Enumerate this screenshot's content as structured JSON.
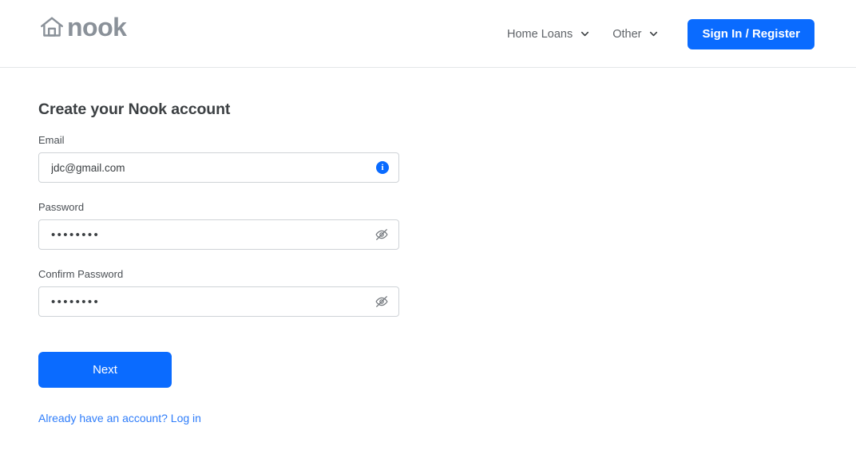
{
  "header": {
    "brand": {
      "icon": "house-icon",
      "text": "nook"
    },
    "nav_items": [
      {
        "label": "Home Loans",
        "icon": "chevron-down-icon"
      },
      {
        "label": "Other",
        "icon": "chevron-down-icon"
      }
    ],
    "signin_button": "Sign In / Register"
  },
  "main": {
    "title": "Create your Nook account",
    "fields": [
      {
        "label": "Email",
        "value": "jdc@gmail.com",
        "placeholder": "",
        "adorn_icon": "info-icon",
        "adorn_glyph": "i"
      },
      {
        "label": "Password",
        "value": "••••••••",
        "placeholder": "",
        "adorn_icon": "eye-off-icon",
        "adorn_glyph": ""
      },
      {
        "label": "Confirm Password",
        "value": "••••••••",
        "placeholder": "",
        "adorn_icon": "eye-off-icon",
        "adorn_glyph": ""
      }
    ],
    "next_button": "Next",
    "login_link": "Already have an account? Log in"
  },
  "colors": {
    "accent": "#0a6bff",
    "link": "#2f7dfa",
    "brand_gray": "#8a9199",
    "text": "#3c4043",
    "border": "#cfd3d7",
    "header_border": "#e4e6e8"
  }
}
